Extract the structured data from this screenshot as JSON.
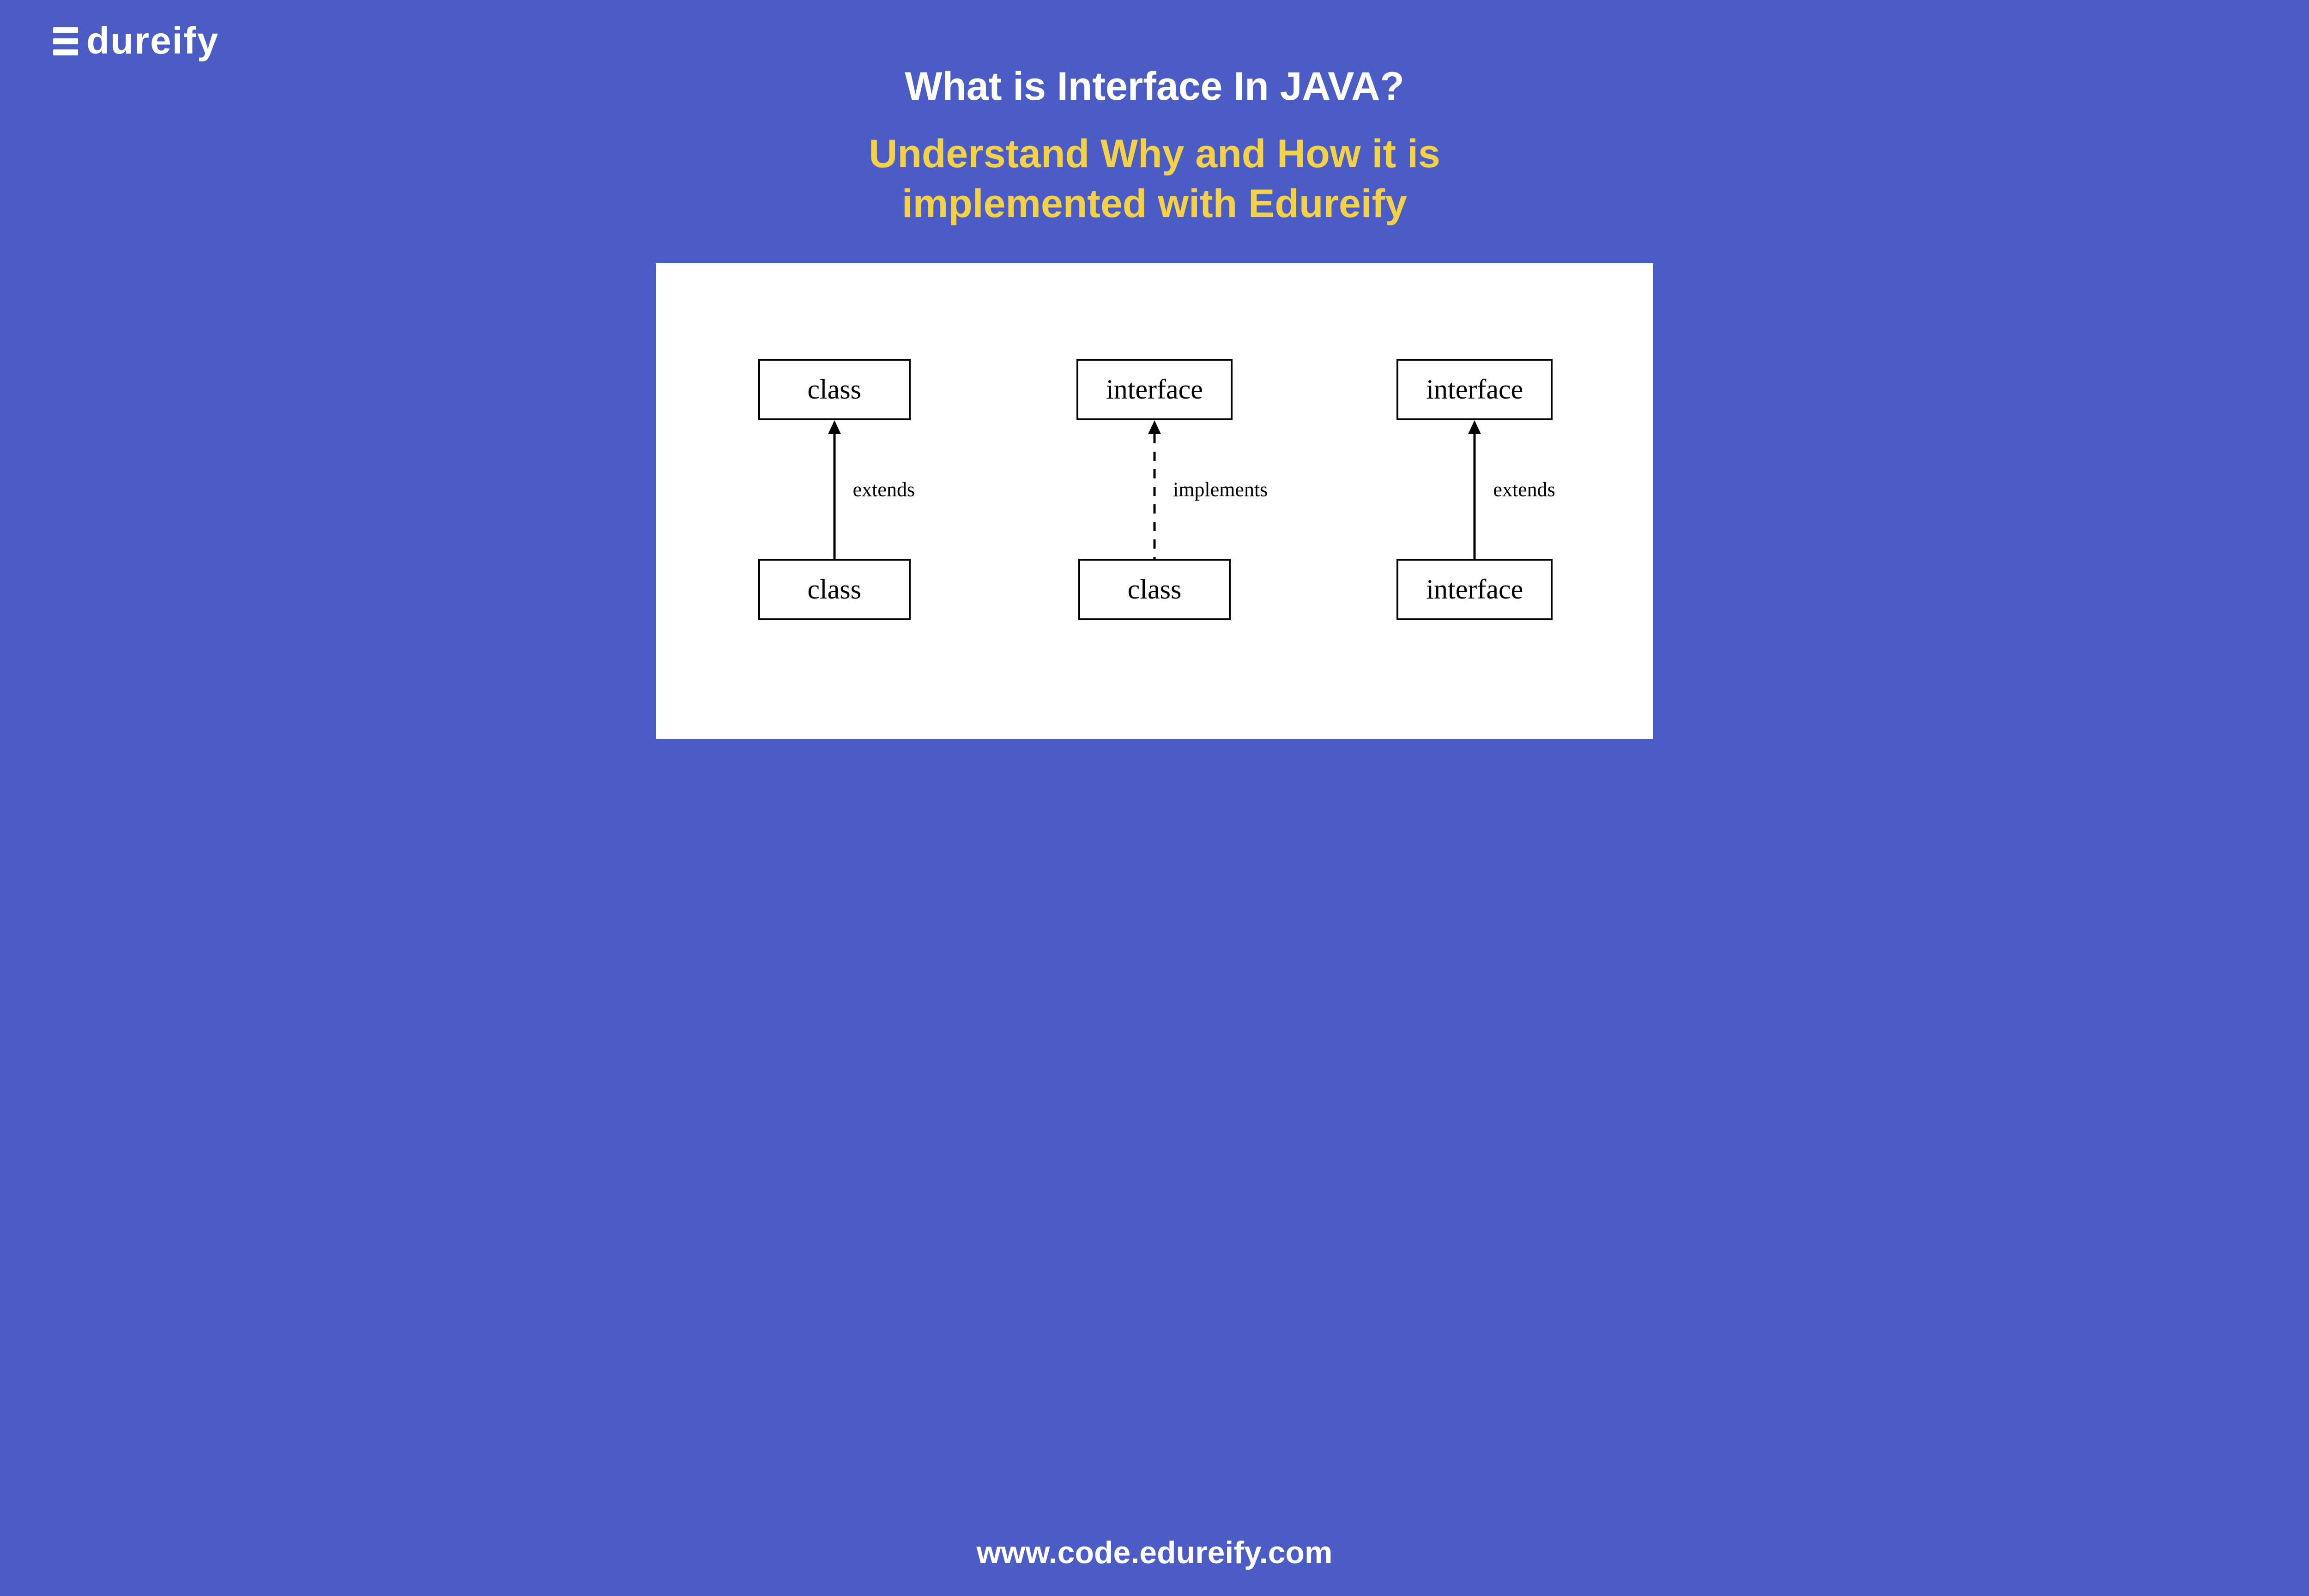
{
  "logo": {
    "text": "dureify"
  },
  "title": "What is Interface In JAVA?",
  "subtitle_line1": "Understand Why and How it is",
  "subtitle_line2": "implemented with Edureify",
  "diagram": {
    "columns": [
      {
        "top": "class",
        "bottom": "class",
        "relation": "extends",
        "dashed": false
      },
      {
        "top": "interface",
        "bottom": "class",
        "relation": "implements",
        "dashed": true
      },
      {
        "top": "interface",
        "bottom": "interface",
        "relation": "extends",
        "dashed": false
      }
    ]
  },
  "footer": "www.code.edureify.com"
}
